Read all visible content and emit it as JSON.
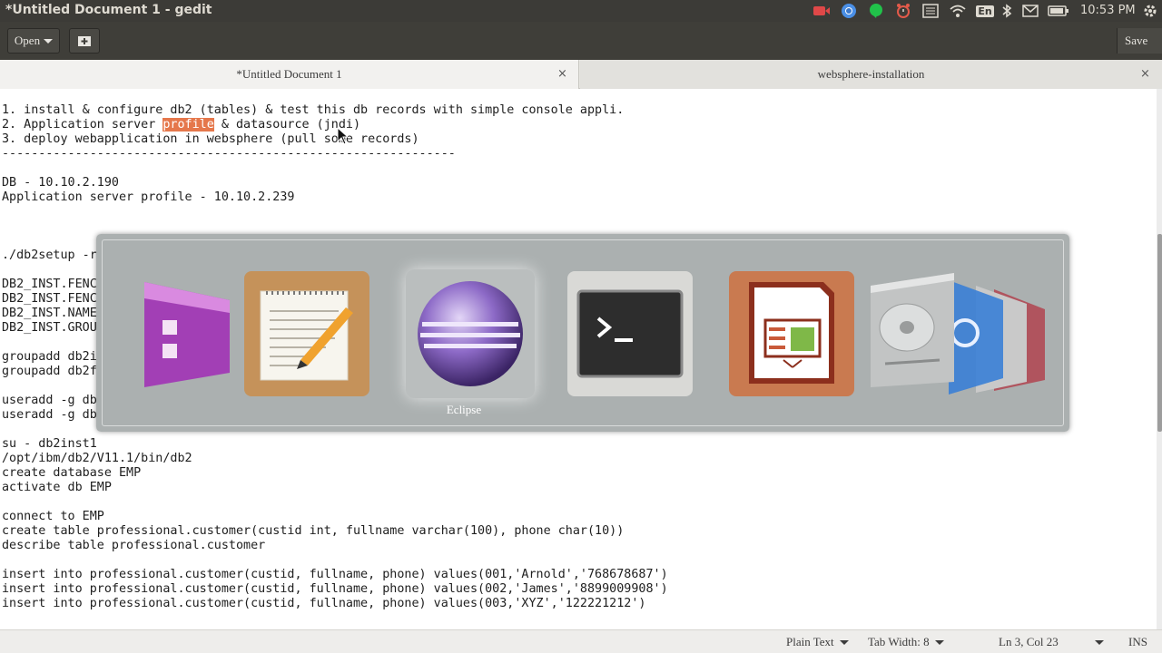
{
  "window": {
    "title": "*Untitled Document 1 - gedit"
  },
  "panel": {
    "clock": "10:53 PM",
    "lang_indicator": "En"
  },
  "toolbar": {
    "open_label": "Open",
    "save_label": "Save"
  },
  "tabs": [
    {
      "label": "*Untitled Document 1",
      "close": "×"
    },
    {
      "label": "websphere-installation",
      "close": "×"
    }
  ],
  "editor": {
    "lines": [
      {
        "text": "1. install & configure db2 (tables) & test this db records with simple console appli."
      },
      {
        "pre": "2. Application server ",
        "match": "profile",
        "post": " & datasource (jndi)"
      },
      {
        "text": "3. deploy webapplication in websphere (pull some records)"
      },
      {
        "text": "--------------------------------------------------------------"
      },
      {
        "text": ""
      },
      {
        "text": "DB - 10.10.2.190"
      },
      {
        "text": "Application server profile - 10.10.2.239"
      },
      {
        "text": ""
      },
      {
        "text": ""
      },
      {
        "text": ""
      },
      {
        "text": "./db2setup -r"
      },
      {
        "text": ""
      },
      {
        "text": "DB2_INST.FENC"
      },
      {
        "text": "DB2_INST.FENC"
      },
      {
        "text": "DB2_INST.NAME"
      },
      {
        "text": "DB2_INST.GROU"
      },
      {
        "text": ""
      },
      {
        "text": "groupadd db2i"
      },
      {
        "text": "groupadd db2f"
      },
      {
        "text": ""
      },
      {
        "text": "useradd -g db"
      },
      {
        "text": "useradd -g db"
      },
      {
        "text": ""
      },
      {
        "text": "su - db2inst1"
      },
      {
        "text": "/opt/ibm/db2/V11.1/bin/db2"
      },
      {
        "text": "create database EMP"
      },
      {
        "text": "activate db EMP"
      },
      {
        "text": ""
      },
      {
        "text": "connect to EMP"
      },
      {
        "text": "create table professional.customer(custid int, fullname varchar(100), phone char(10))"
      },
      {
        "text": "describe table professional.customer"
      },
      {
        "text": ""
      },
      {
        "text": "insert into professional.customer(custid, fullname, phone) values(001,'Arnold','768678687')"
      },
      {
        "text": "insert into professional.customer(custid, fullname, phone) values(002,'James','8899009908')"
      },
      {
        "text": "insert into professional.customer(custid, fullname, phone) values(003,'XYZ','122221212')"
      }
    ]
  },
  "switcher": {
    "selected_label": "Eclipse",
    "apps": [
      "purple-app-icon",
      "gedit-icon",
      "eclipse-icon",
      "terminal-icon",
      "libreoffice-impress-icon",
      "disk-utility-icon"
    ]
  },
  "status": {
    "language": "Plain Text",
    "tab_width": "Tab Width: 8",
    "position": "Ln 3, Col 23",
    "mode": "INS"
  },
  "colors": {
    "panel": "#3c3b37",
    "highlight": "#e5774b",
    "switcher": "#a5aaaa"
  }
}
